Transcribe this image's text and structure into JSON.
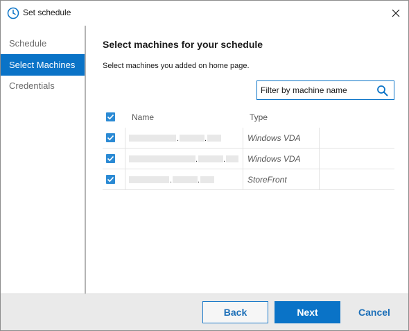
{
  "window": {
    "title": "Set schedule",
    "accent_color": "#0a73c7"
  },
  "sidebar": {
    "items": [
      {
        "label": "Schedule",
        "active": false
      },
      {
        "label": "Select Machines",
        "active": true
      },
      {
        "label": "Credentials",
        "active": false
      }
    ]
  },
  "main": {
    "heading": "Select machines for your schedule",
    "subheading": "Select machines you added on home page.",
    "filter": {
      "placeholder": "Filter by machine name",
      "value": ""
    },
    "table": {
      "select_all_checked": true,
      "columns": [
        "Name",
        "Type"
      ],
      "rows": [
        {
          "checked": true,
          "name_redacted": true,
          "type": "Windows VDA"
        },
        {
          "checked": true,
          "name_redacted": true,
          "type": "Windows VDA"
        },
        {
          "checked": true,
          "name_redacted": true,
          "type": "StoreFront"
        }
      ]
    }
  },
  "footer": {
    "back_label": "Back",
    "next_label": "Next",
    "cancel_label": "Cancel"
  }
}
